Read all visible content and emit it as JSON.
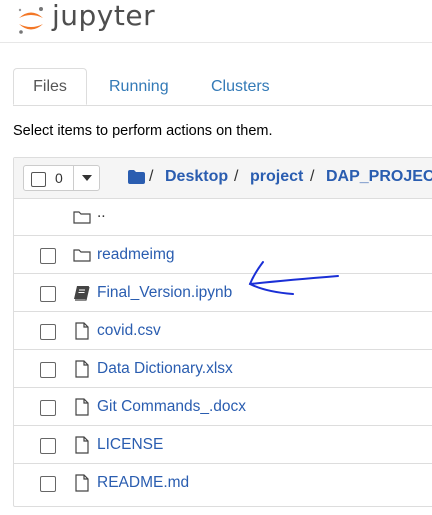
{
  "app": {
    "logo_text": "jupyter"
  },
  "tabs": [
    {
      "label": "Files",
      "active": true
    },
    {
      "label": "Running",
      "active": false
    },
    {
      "label": "Clusters",
      "active": false
    }
  ],
  "toolbar": {
    "hint": "Select items to perform actions on them.",
    "selected_count": "0"
  },
  "breadcrumb": {
    "separator": "/",
    "items": [
      "Desktop",
      "project",
      "DAP_PROJEC"
    ]
  },
  "files": [
    {
      "name": "..",
      "icon": "folder-icon",
      "type": "up"
    },
    {
      "name": "readmeimg",
      "icon": "folder-icon",
      "type": "folder"
    },
    {
      "name": "Final_Version.ipynb",
      "icon": "notebook-icon",
      "type": "notebook"
    },
    {
      "name": "covid.csv",
      "icon": "file-icon",
      "type": "file"
    },
    {
      "name": "Data Dictionary.xlsx",
      "icon": "file-icon",
      "type": "file"
    },
    {
      "name": "Git Commands_.docx",
      "icon": "file-icon",
      "type": "file"
    },
    {
      "name": "LICENSE",
      "icon": "file-icon",
      "type": "file"
    },
    {
      "name": "README.md",
      "icon": "file-icon",
      "type": "file"
    }
  ],
  "colors": {
    "link": "#2a5db0",
    "logo_orange": "#f37726",
    "annotation": "#1a2fd6"
  }
}
